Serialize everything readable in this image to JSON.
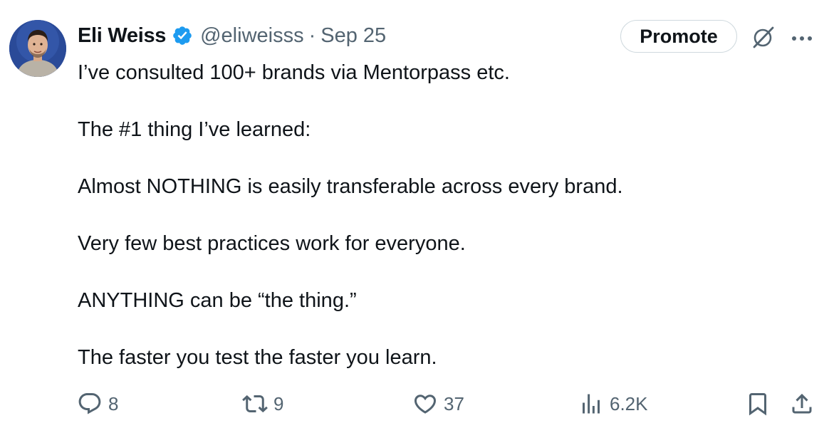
{
  "author": {
    "name": "Eli Weiss",
    "handle": "@eliweisss",
    "separator": "·",
    "date": "Sep 25",
    "verified": true
  },
  "header_actions": {
    "promote_label": "Promote",
    "grok_icon": "grok-icon",
    "more_icon": "more-icon"
  },
  "tweet": {
    "lines": [
      "I’ve consulted 100+ brands via Mentorpass etc.",
      "The #1 thing I’ve learned:",
      "Almost NOTHING is easily transferable across every brand.",
      "Very few best practices work for everyone.",
      "ANYTHING can be “the thing.”",
      "The faster you test the faster you learn."
    ]
  },
  "actions": {
    "replies": "8",
    "reposts": "9",
    "likes": "37",
    "views": "6.2K"
  },
  "colors": {
    "text": "#0f1419",
    "secondary": "#536471",
    "verified": "#1d9bf0",
    "border": "#cfd9de"
  }
}
